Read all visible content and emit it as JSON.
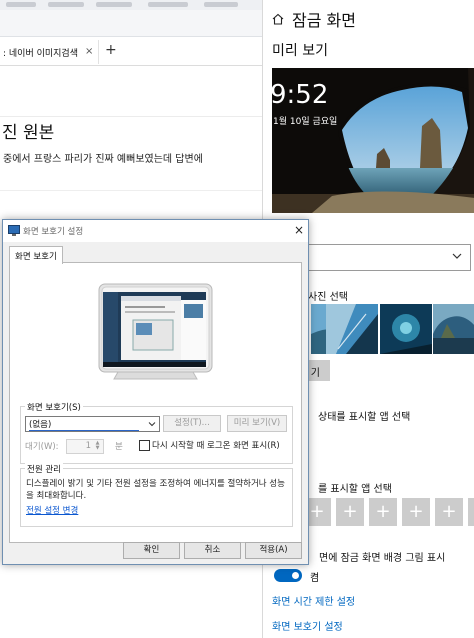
{
  "browser": {
    "tab_title": ": 네이버 이미지검색",
    "tab_close": "×",
    "new_tab": "+",
    "page_title": "진 원본",
    "page_text": "중에서 프랑스 파리가 진짜 예뻐보였는데 답변에"
  },
  "settings": {
    "title": "잠금 화면",
    "preview_label": "미리 보기",
    "clock": "9:52",
    "date": "1월 10일 금요일",
    "photo_label": "사진 선택",
    "browse_label": "기",
    "status_label": "상태를 표시할 앱 선택",
    "quick_label": "를 표시할 앱 선택",
    "plus": "+",
    "show_bg_label": "면에 잠금 화면 배경 그림 표시",
    "toggle_state": "켬",
    "toggle_on": true,
    "timeout_link": "화면 시간 제한 설정",
    "saver_link": "화면 보호기 설정",
    "accent": "#0067c0"
  },
  "dialog": {
    "title": "화면 보호기 설정",
    "close": "×",
    "tab": "화면 보호기",
    "group_saver": "화면 보호기(S)",
    "selected_saver": "(없음)",
    "settings_button": "설정(T)...",
    "preview_button": "미리 보기(V)",
    "wait_label": "대기(W):",
    "wait_value": "1",
    "wait_unit": "분",
    "resume_label": "다시 시작할 때 로그온 화면 표시(R)",
    "resume_checked": false,
    "group_power": "전원 관리",
    "power_desc": "디스플레이 밝기 및 기타 전원 설정을 조정하여 에너지를 절약하거나 성능을 최대화합니다.",
    "power_link": "전원 설정 변경",
    "ok": "확인",
    "cancel": "취소",
    "apply": "적용(A)"
  }
}
